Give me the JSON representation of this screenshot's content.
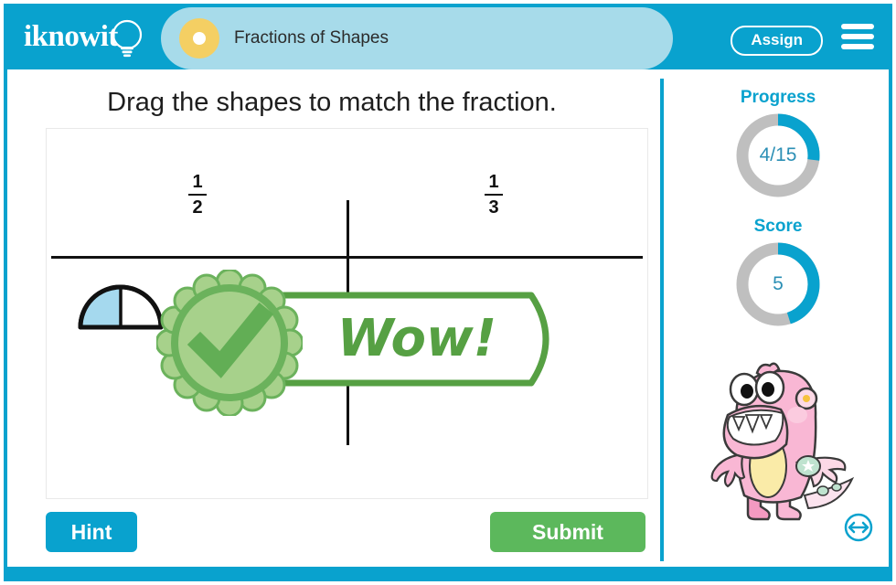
{
  "header": {
    "logo_text": "iknowit",
    "logo_icon": "lightbulb-icon",
    "title": "Fractions of Shapes",
    "title_dot_icon": "yellow-dot-icon",
    "assign_label": "Assign",
    "menu_icon": "hamburger-menu-icon",
    "bg_color": "#09A2CE",
    "title_tab_color": "#A7DBEA",
    "title_dot_color": "#F4CF63"
  },
  "main": {
    "question": "Drag the shapes to match the fraction.",
    "columns": [
      {
        "numerator": "1",
        "denominator": "2"
      },
      {
        "numerator": "1",
        "denominator": "3"
      }
    ],
    "shape": {
      "name": "semicircle-half-shaded",
      "kind": "semicircle",
      "parts": 2,
      "shaded_parts": 1,
      "fill_color": "#A5D9EE",
      "stroke_color": "#111111"
    },
    "feedback": {
      "text": "Wow!",
      "icon": "check-mark-rosette-icon",
      "color": "#56A043",
      "badge_fill": "#A7D18B",
      "badge_ring": "#6BB25C"
    },
    "hint_label": "Hint",
    "submit_label": "Submit",
    "hint_color": "#09A2CE",
    "submit_color": "#5CB85C"
  },
  "sidebar": {
    "progress_label": "Progress",
    "progress_value": "4/15",
    "progress_percent": 27,
    "score_label": "Score",
    "score_value": "5",
    "score_percent": 45,
    "ring_fill_color": "#09A2CE",
    "ring_track_color": "#BFBFBF",
    "mascot_icon": "pink-monster-mascot",
    "resize_icon": "expand-horizontal-arrow-icon"
  }
}
